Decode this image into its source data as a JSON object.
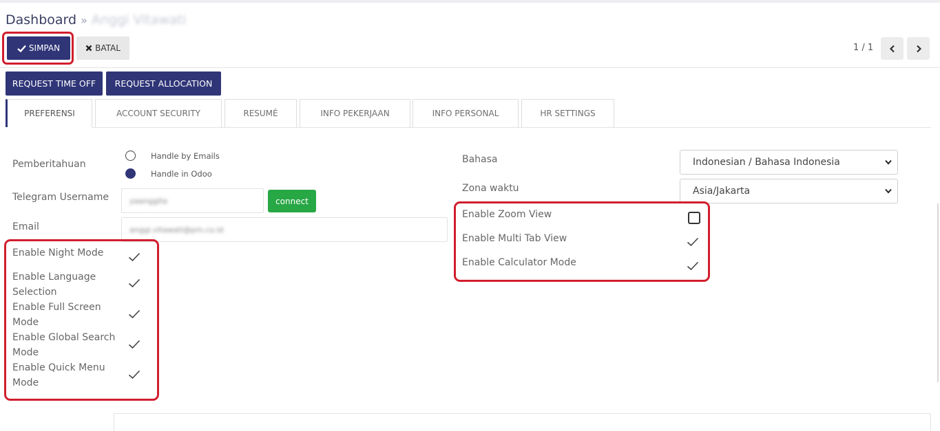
{
  "breadcrumb": {
    "root": "Dashboard",
    "separator": "»",
    "current": "Anggi Vitawati"
  },
  "toolbar": {
    "save_label": "SIMPAN",
    "cancel_label": "BATAL",
    "pager": "1 / 1"
  },
  "actions": {
    "request_time_off": "REQUEST TIME OFF",
    "request_allocation": "REQUEST ALLOCATION"
  },
  "tabs": [
    {
      "label": "PREFERENSI",
      "active": true
    },
    {
      "label": "ACCOUNT SECURITY",
      "active": false
    },
    {
      "label": "RESUMÉ",
      "active": false
    },
    {
      "label": "INFO PEKERJAAN",
      "active": false
    },
    {
      "label": "INFO PERSONAL",
      "active": false
    },
    {
      "label": "HR SETTINGS",
      "active": false
    }
  ],
  "form": {
    "notification_label": "Pemberitahuan",
    "notification_options": [
      {
        "label": "Handle by Emails",
        "selected": false
      },
      {
        "label": "Handle in Odoo",
        "selected": true
      }
    ],
    "telegram_label": "Telegram Username",
    "telegram_value": "yaanggita",
    "connect_label": "connect",
    "email_label": "Email",
    "email_value": "anggi.vitawati@pm.co.id",
    "language_label": "Bahasa",
    "language_value": "Indonesian / Bahasa Indonesia",
    "timezone_label": "Zona waktu",
    "timezone_value": "Asia/Jakarta"
  },
  "left_toggles": [
    {
      "line1": "Enable Night Mode",
      "line2": "",
      "checked": true
    },
    {
      "line1": "Enable Language",
      "line2": "Selection",
      "checked": true
    },
    {
      "line1": "Enable Full Screen",
      "line2": "Mode",
      "checked": true
    },
    {
      "line1": "Enable Global Search",
      "line2": "Mode",
      "checked": true
    },
    {
      "line1": "Enable Quick Menu",
      "line2": "Mode",
      "checked": true
    }
  ],
  "right_toggles": [
    {
      "label": "Enable Zoom View",
      "checked": false
    },
    {
      "label": "Enable Multi Tab View",
      "checked": true
    },
    {
      "label": "Enable Calculator Mode",
      "checked": true
    }
  ],
  "colors": {
    "primary": "#2f3577",
    "connect": "#28a745",
    "highlight": "#d11e2d"
  }
}
